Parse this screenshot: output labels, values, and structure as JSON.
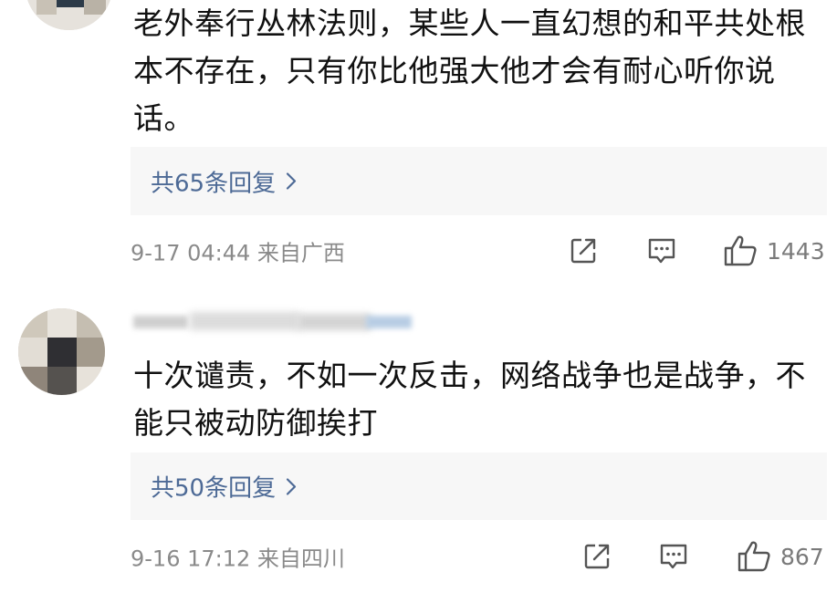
{
  "comments": [
    {
      "text": "老外奉行丛林法则，某些人一直幻想的和平共处根本不存在，只有你比他强大他才会有耐心听你说话。",
      "reply_label": "共65条回复",
      "time_location": "9-17 04:44  来自广西",
      "likes": "1443"
    },
    {
      "text": "十次谴责，不如一次反击，网络战争也是战争，不能只被动防御挨打",
      "reply_label": "共50条回复",
      "time_location": "9-16 17:12  来自四川",
      "likes": "867"
    }
  ],
  "icons": {
    "share": "share-icon",
    "comment": "comment-icon",
    "like": "thumbs-up-icon",
    "chevron": "chevron-right-icon"
  },
  "colors": {
    "reply_link": "#4d6a96",
    "meta_text": "#8a8a8a",
    "reply_bg": "#f7f7f7",
    "icon": "#555555"
  }
}
